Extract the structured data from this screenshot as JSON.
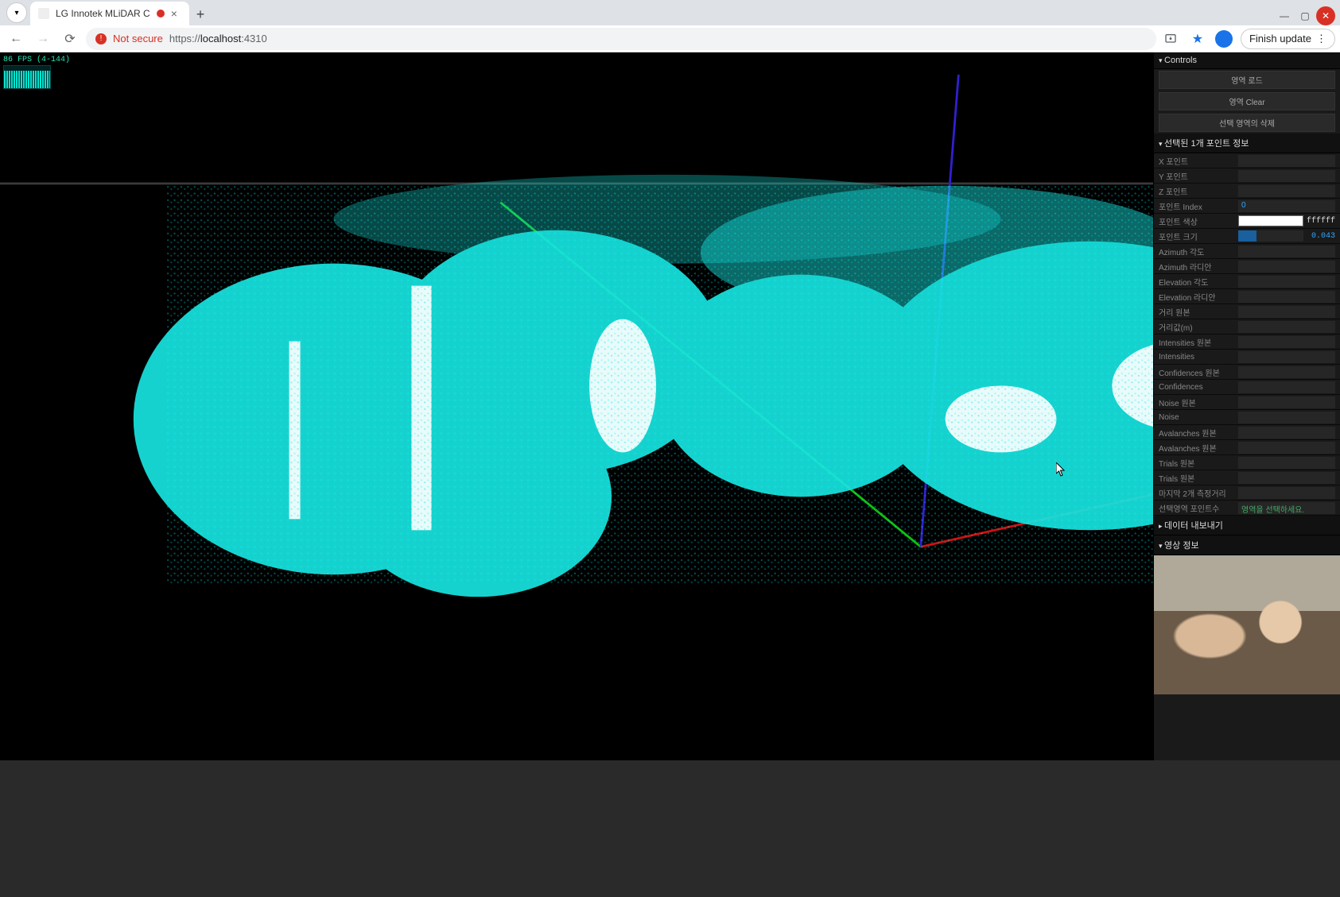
{
  "browser": {
    "tab_title": "LG Innotek MLiDAR C",
    "url_scheme": "https://",
    "url_host": "localhost",
    "url_port": ":4310",
    "not_secure_label": "Not secure",
    "finish_update_label": "Finish update"
  },
  "viewport": {
    "fps_label": "86 FPS (4-144)"
  },
  "panel": {
    "controls_title": "Controls",
    "actions": {
      "area_load": "영역 로드",
      "area_clear": "영역 Clear",
      "delete_selected_area": "선택 영역의 삭제"
    },
    "point_info_title": "선택된 1개 포인트 정보",
    "rows": {
      "x_point": "X 포인트",
      "y_point": "Y 포인트",
      "z_point": "Z 포인트",
      "point_index": "포인트 Index",
      "point_index_val": "0",
      "point_color": "포인트 색상",
      "point_color_hex": "ffffff",
      "point_size": "포인트 크기",
      "point_size_val": "0.043",
      "azimuth_deg": "Azimuth 각도",
      "azimuth_rad": "Azimuth 라디안",
      "elevation_deg": "Elevation 각도",
      "elevation_rad": "Elevation 라디안",
      "distance_raw": "거리 원본",
      "distance_m": "거리값(m)",
      "intensities_raw": "Intensities 원본",
      "intensities": "Intensities",
      "confidences_raw": "Confidences 원본",
      "confidences": "Confidences",
      "noise_raw": "Noise 원본",
      "noise": "Noise",
      "avalanches_raw": "Avalanches 원본",
      "avalanches_raw2": "Avalanches 원본",
      "trials_raw": "Trials 원본",
      "trials_raw2": "Trials 원본",
      "last_2_distance": "마지막 2개 측정거리",
      "selected_area_points": "선택영역 포인트수",
      "selected_area_placeholder": "영역을 선택하세요."
    },
    "export_title": "데이터 내보내기",
    "video_title": "영상 정보"
  }
}
